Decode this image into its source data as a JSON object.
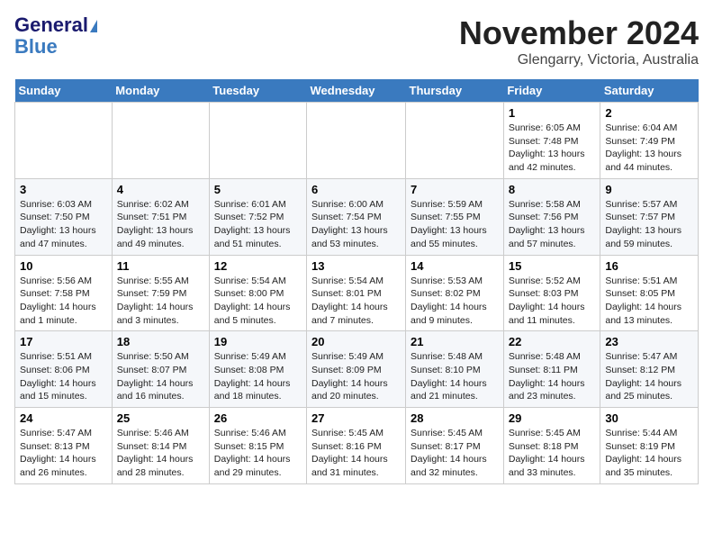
{
  "logo": {
    "line1": "General",
    "line2": "Blue"
  },
  "title": "November 2024",
  "location": "Glengarry, Victoria, Australia",
  "weekdays": [
    "Sunday",
    "Monday",
    "Tuesday",
    "Wednesday",
    "Thursday",
    "Friday",
    "Saturday"
  ],
  "weeks": [
    [
      {
        "day": "",
        "info": ""
      },
      {
        "day": "",
        "info": ""
      },
      {
        "day": "",
        "info": ""
      },
      {
        "day": "",
        "info": ""
      },
      {
        "day": "",
        "info": ""
      },
      {
        "day": "1",
        "info": "Sunrise: 6:05 AM\nSunset: 7:48 PM\nDaylight: 13 hours\nand 42 minutes."
      },
      {
        "day": "2",
        "info": "Sunrise: 6:04 AM\nSunset: 7:49 PM\nDaylight: 13 hours\nand 44 minutes."
      }
    ],
    [
      {
        "day": "3",
        "info": "Sunrise: 6:03 AM\nSunset: 7:50 PM\nDaylight: 13 hours\nand 47 minutes."
      },
      {
        "day": "4",
        "info": "Sunrise: 6:02 AM\nSunset: 7:51 PM\nDaylight: 13 hours\nand 49 minutes."
      },
      {
        "day": "5",
        "info": "Sunrise: 6:01 AM\nSunset: 7:52 PM\nDaylight: 13 hours\nand 51 minutes."
      },
      {
        "day": "6",
        "info": "Sunrise: 6:00 AM\nSunset: 7:54 PM\nDaylight: 13 hours\nand 53 minutes."
      },
      {
        "day": "7",
        "info": "Sunrise: 5:59 AM\nSunset: 7:55 PM\nDaylight: 13 hours\nand 55 minutes."
      },
      {
        "day": "8",
        "info": "Sunrise: 5:58 AM\nSunset: 7:56 PM\nDaylight: 13 hours\nand 57 minutes."
      },
      {
        "day": "9",
        "info": "Sunrise: 5:57 AM\nSunset: 7:57 PM\nDaylight: 13 hours\nand 59 minutes."
      }
    ],
    [
      {
        "day": "10",
        "info": "Sunrise: 5:56 AM\nSunset: 7:58 PM\nDaylight: 14 hours\nand 1 minute."
      },
      {
        "day": "11",
        "info": "Sunrise: 5:55 AM\nSunset: 7:59 PM\nDaylight: 14 hours\nand 3 minutes."
      },
      {
        "day": "12",
        "info": "Sunrise: 5:54 AM\nSunset: 8:00 PM\nDaylight: 14 hours\nand 5 minutes."
      },
      {
        "day": "13",
        "info": "Sunrise: 5:54 AM\nSunset: 8:01 PM\nDaylight: 14 hours\nand 7 minutes."
      },
      {
        "day": "14",
        "info": "Sunrise: 5:53 AM\nSunset: 8:02 PM\nDaylight: 14 hours\nand 9 minutes."
      },
      {
        "day": "15",
        "info": "Sunrise: 5:52 AM\nSunset: 8:03 PM\nDaylight: 14 hours\nand 11 minutes."
      },
      {
        "day": "16",
        "info": "Sunrise: 5:51 AM\nSunset: 8:05 PM\nDaylight: 14 hours\nand 13 minutes."
      }
    ],
    [
      {
        "day": "17",
        "info": "Sunrise: 5:51 AM\nSunset: 8:06 PM\nDaylight: 14 hours\nand 15 minutes."
      },
      {
        "day": "18",
        "info": "Sunrise: 5:50 AM\nSunset: 8:07 PM\nDaylight: 14 hours\nand 16 minutes."
      },
      {
        "day": "19",
        "info": "Sunrise: 5:49 AM\nSunset: 8:08 PM\nDaylight: 14 hours\nand 18 minutes."
      },
      {
        "day": "20",
        "info": "Sunrise: 5:49 AM\nSunset: 8:09 PM\nDaylight: 14 hours\nand 20 minutes."
      },
      {
        "day": "21",
        "info": "Sunrise: 5:48 AM\nSunset: 8:10 PM\nDaylight: 14 hours\nand 21 minutes."
      },
      {
        "day": "22",
        "info": "Sunrise: 5:48 AM\nSunset: 8:11 PM\nDaylight: 14 hours\nand 23 minutes."
      },
      {
        "day": "23",
        "info": "Sunrise: 5:47 AM\nSunset: 8:12 PM\nDaylight: 14 hours\nand 25 minutes."
      }
    ],
    [
      {
        "day": "24",
        "info": "Sunrise: 5:47 AM\nSunset: 8:13 PM\nDaylight: 14 hours\nand 26 minutes."
      },
      {
        "day": "25",
        "info": "Sunrise: 5:46 AM\nSunset: 8:14 PM\nDaylight: 14 hours\nand 28 minutes."
      },
      {
        "day": "26",
        "info": "Sunrise: 5:46 AM\nSunset: 8:15 PM\nDaylight: 14 hours\nand 29 minutes."
      },
      {
        "day": "27",
        "info": "Sunrise: 5:45 AM\nSunset: 8:16 PM\nDaylight: 14 hours\nand 31 minutes."
      },
      {
        "day": "28",
        "info": "Sunrise: 5:45 AM\nSunset: 8:17 PM\nDaylight: 14 hours\nand 32 minutes."
      },
      {
        "day": "29",
        "info": "Sunrise: 5:45 AM\nSunset: 8:18 PM\nDaylight: 14 hours\nand 33 minutes."
      },
      {
        "day": "30",
        "info": "Sunrise: 5:44 AM\nSunset: 8:19 PM\nDaylight: 14 hours\nand 35 minutes."
      }
    ]
  ]
}
